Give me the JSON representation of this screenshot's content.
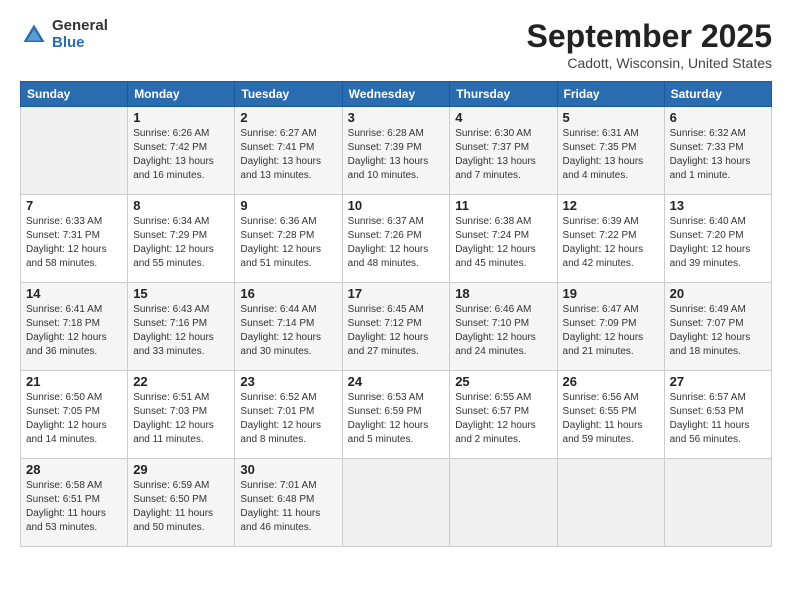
{
  "logo": {
    "general": "General",
    "blue": "Blue"
  },
  "title": "September 2025",
  "location": "Cadott, Wisconsin, United States",
  "days_of_week": [
    "Sunday",
    "Monday",
    "Tuesday",
    "Wednesday",
    "Thursday",
    "Friday",
    "Saturday"
  ],
  "weeks": [
    [
      {
        "day": "",
        "info": ""
      },
      {
        "day": "1",
        "info": "Sunrise: 6:26 AM\nSunset: 7:42 PM\nDaylight: 13 hours\nand 16 minutes."
      },
      {
        "day": "2",
        "info": "Sunrise: 6:27 AM\nSunset: 7:41 PM\nDaylight: 13 hours\nand 13 minutes."
      },
      {
        "day": "3",
        "info": "Sunrise: 6:28 AM\nSunset: 7:39 PM\nDaylight: 13 hours\nand 10 minutes."
      },
      {
        "day": "4",
        "info": "Sunrise: 6:30 AM\nSunset: 7:37 PM\nDaylight: 13 hours\nand 7 minutes."
      },
      {
        "day": "5",
        "info": "Sunrise: 6:31 AM\nSunset: 7:35 PM\nDaylight: 13 hours\nand 4 minutes."
      },
      {
        "day": "6",
        "info": "Sunrise: 6:32 AM\nSunset: 7:33 PM\nDaylight: 13 hours\nand 1 minute."
      }
    ],
    [
      {
        "day": "7",
        "info": "Sunrise: 6:33 AM\nSunset: 7:31 PM\nDaylight: 12 hours\nand 58 minutes."
      },
      {
        "day": "8",
        "info": "Sunrise: 6:34 AM\nSunset: 7:29 PM\nDaylight: 12 hours\nand 55 minutes."
      },
      {
        "day": "9",
        "info": "Sunrise: 6:36 AM\nSunset: 7:28 PM\nDaylight: 12 hours\nand 51 minutes."
      },
      {
        "day": "10",
        "info": "Sunrise: 6:37 AM\nSunset: 7:26 PM\nDaylight: 12 hours\nand 48 minutes."
      },
      {
        "day": "11",
        "info": "Sunrise: 6:38 AM\nSunset: 7:24 PM\nDaylight: 12 hours\nand 45 minutes."
      },
      {
        "day": "12",
        "info": "Sunrise: 6:39 AM\nSunset: 7:22 PM\nDaylight: 12 hours\nand 42 minutes."
      },
      {
        "day": "13",
        "info": "Sunrise: 6:40 AM\nSunset: 7:20 PM\nDaylight: 12 hours\nand 39 minutes."
      }
    ],
    [
      {
        "day": "14",
        "info": "Sunrise: 6:41 AM\nSunset: 7:18 PM\nDaylight: 12 hours\nand 36 minutes."
      },
      {
        "day": "15",
        "info": "Sunrise: 6:43 AM\nSunset: 7:16 PM\nDaylight: 12 hours\nand 33 minutes."
      },
      {
        "day": "16",
        "info": "Sunrise: 6:44 AM\nSunset: 7:14 PM\nDaylight: 12 hours\nand 30 minutes."
      },
      {
        "day": "17",
        "info": "Sunrise: 6:45 AM\nSunset: 7:12 PM\nDaylight: 12 hours\nand 27 minutes."
      },
      {
        "day": "18",
        "info": "Sunrise: 6:46 AM\nSunset: 7:10 PM\nDaylight: 12 hours\nand 24 minutes."
      },
      {
        "day": "19",
        "info": "Sunrise: 6:47 AM\nSunset: 7:09 PM\nDaylight: 12 hours\nand 21 minutes."
      },
      {
        "day": "20",
        "info": "Sunrise: 6:49 AM\nSunset: 7:07 PM\nDaylight: 12 hours\nand 18 minutes."
      }
    ],
    [
      {
        "day": "21",
        "info": "Sunrise: 6:50 AM\nSunset: 7:05 PM\nDaylight: 12 hours\nand 14 minutes."
      },
      {
        "day": "22",
        "info": "Sunrise: 6:51 AM\nSunset: 7:03 PM\nDaylight: 12 hours\nand 11 minutes."
      },
      {
        "day": "23",
        "info": "Sunrise: 6:52 AM\nSunset: 7:01 PM\nDaylight: 12 hours\nand 8 minutes."
      },
      {
        "day": "24",
        "info": "Sunrise: 6:53 AM\nSunset: 6:59 PM\nDaylight: 12 hours\nand 5 minutes."
      },
      {
        "day": "25",
        "info": "Sunrise: 6:55 AM\nSunset: 6:57 PM\nDaylight: 12 hours\nand 2 minutes."
      },
      {
        "day": "26",
        "info": "Sunrise: 6:56 AM\nSunset: 6:55 PM\nDaylight: 11 hours\nand 59 minutes."
      },
      {
        "day": "27",
        "info": "Sunrise: 6:57 AM\nSunset: 6:53 PM\nDaylight: 11 hours\nand 56 minutes."
      }
    ],
    [
      {
        "day": "28",
        "info": "Sunrise: 6:58 AM\nSunset: 6:51 PM\nDaylight: 11 hours\nand 53 minutes."
      },
      {
        "day": "29",
        "info": "Sunrise: 6:59 AM\nSunset: 6:50 PM\nDaylight: 11 hours\nand 50 minutes."
      },
      {
        "day": "30",
        "info": "Sunrise: 7:01 AM\nSunset: 6:48 PM\nDaylight: 11 hours\nand 46 minutes."
      },
      {
        "day": "",
        "info": ""
      },
      {
        "day": "",
        "info": ""
      },
      {
        "day": "",
        "info": ""
      },
      {
        "day": "",
        "info": ""
      }
    ]
  ]
}
